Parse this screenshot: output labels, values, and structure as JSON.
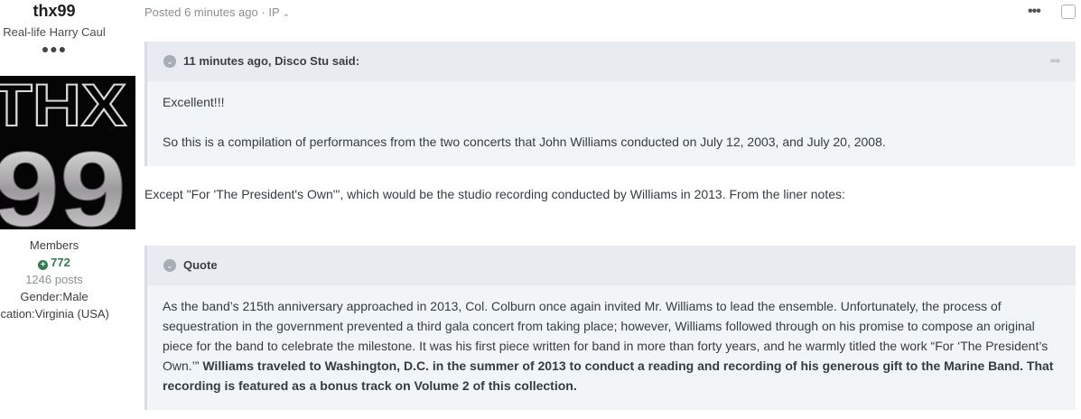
{
  "author": {
    "name": "thx99",
    "title": "Real-life Harry Caul",
    "rank_dots": "●●●",
    "avatar_text_top": "THX",
    "avatar_text_bottom": "99",
    "group": "Members",
    "reputation": "772",
    "posts": "1246 posts",
    "gender": "Gender:Male",
    "location": "Location:Virginia (USA)"
  },
  "post": {
    "posted": "Posted 6 minutes ago",
    "separator": "·",
    "ip_label": "IP",
    "quote1": {
      "cite": "11 minutes ago, Disco Stu said:",
      "line1": "Excellent!!!",
      "line2": "So this is a compilation of performances from the two concerts that John Williams conducted on July 12, 2003, and July 20, 2008."
    },
    "body_text": "Except \"For 'The President's Own'\", which would be the studio recording conducted by Williams in 2013.  From the liner notes:",
    "quote2": {
      "cite": "Quote",
      "text_plain": "As the band’s 215th anniversary approached in 2013, Col. Colburn once again invited Mr. Williams to lead the ensemble. Unfortunately, the process of sequestration in the government prevented a third gala concert from taking place; however, Williams followed through on his promise to compose an original piece for the band to celebrate the milestone. It was his first piece written for band in more than forty years, and he warmly titled the work “For ‘The President’s Own.’” ",
      "text_bold": "Williams traveled to Washington, D.C. in the summer of 2013 to conduct a reading and recording of his generous gift to the Marine Band. That recording is featured as a bonus track on Volume 2 of this collection."
    }
  },
  "icons": {
    "more": "more-icon",
    "share": "share-icon",
    "toggle": "chevron-down-icon",
    "reputation": "plus-circle-icon"
  },
  "colors": {
    "reputation": "#2e7d4f",
    "quote_bg": "#f2f5f8",
    "quote_head_bg": "#e8ecf0"
  }
}
